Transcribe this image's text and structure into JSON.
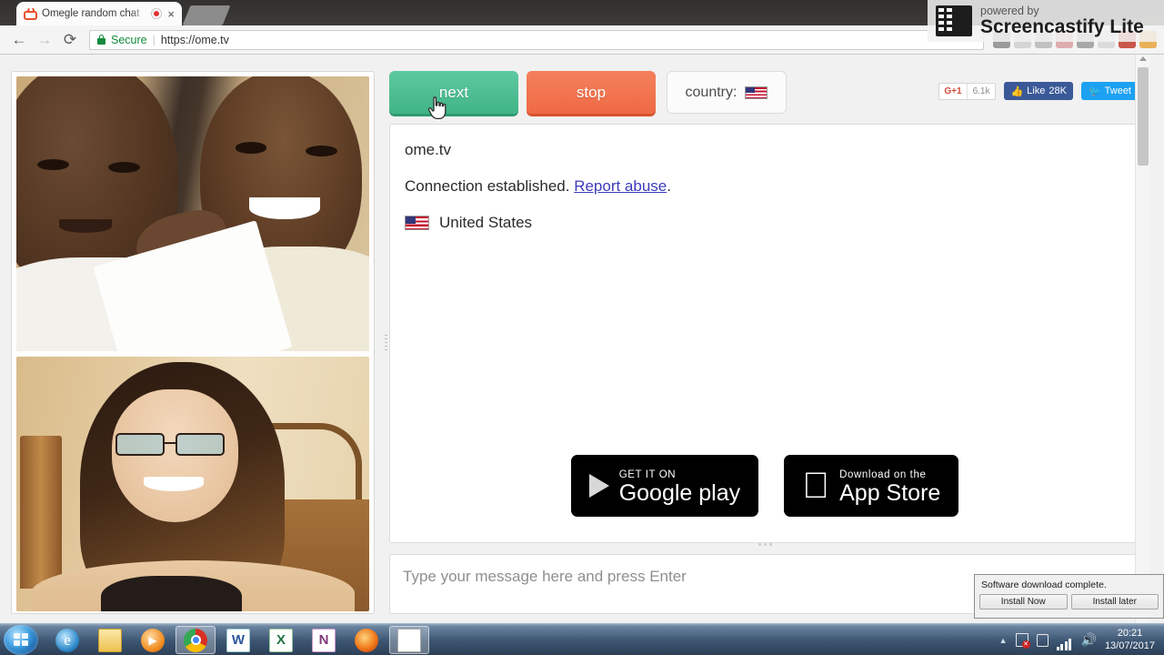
{
  "browser": {
    "tab": {
      "title": "Omegle random chat",
      "favicon": "tv-icon",
      "recording_indicator": "record-dot",
      "close": "×"
    },
    "nav": {
      "back": "←",
      "forward": "→",
      "reload": "⟳"
    },
    "omnibox": {
      "security_label": "Secure",
      "separator": "|",
      "url": "https://ome.tv"
    }
  },
  "overlay": {
    "powered_by": "powered by",
    "product": "Screencastify Lite"
  },
  "site": {
    "controls": {
      "next_label": "next",
      "stop_label": "stop",
      "country_label": "country:",
      "country_flag": "us-flag"
    },
    "social": {
      "gplus_label": "G+1",
      "gplus_count": "6.1k",
      "facebook_label": "Like",
      "facebook_count": "28K",
      "twitter_label": "Tweet"
    },
    "chat": {
      "lines": [
        {
          "text": "ome.tv"
        },
        {
          "text": "Connection established. ",
          "link": "Report abuse",
          "suffix": "."
        }
      ],
      "country_name": "United States",
      "country_flag": "us-flag"
    },
    "stores": [
      {
        "small": "GET IT ON",
        "big": "Google play",
        "icon": "google-play-icon"
      },
      {
        "small": "Download on the",
        "big": "App Store",
        "icon": "apple-icon"
      }
    ],
    "message_input": {
      "placeholder": "Type your message here and press Enter",
      "value": ""
    },
    "video": {
      "remote_label": "remote-video",
      "local_label": "local-video"
    }
  },
  "notification": {
    "message": "Software download complete.",
    "primary_button": "Install Now",
    "secondary_button": "Install later"
  },
  "taskbar": {
    "start": "start-orb",
    "items": [
      {
        "name": "internet-explorer"
      },
      {
        "name": "windows-explorer"
      },
      {
        "name": "windows-media-player"
      },
      {
        "name": "google-chrome",
        "active": true
      },
      {
        "name": "microsoft-word"
      },
      {
        "name": "microsoft-excel"
      },
      {
        "name": "microsoft-onenote"
      },
      {
        "name": "mozilla-firefox"
      },
      {
        "name": "document-window"
      }
    ],
    "tray": {
      "chevron": "▲",
      "flag": "action-center",
      "network": "network",
      "volume": "volume"
    },
    "clock": {
      "time": "20:21",
      "date": "13/07/2017"
    }
  },
  "colors": {
    "next_green": "#40b487",
    "stop_orange": "#ef6a44",
    "link_blue": "#3b3bbd",
    "secure_green": "#128a3c",
    "facebook_blue": "#3b5998",
    "twitter_blue": "#1da1f2"
  }
}
